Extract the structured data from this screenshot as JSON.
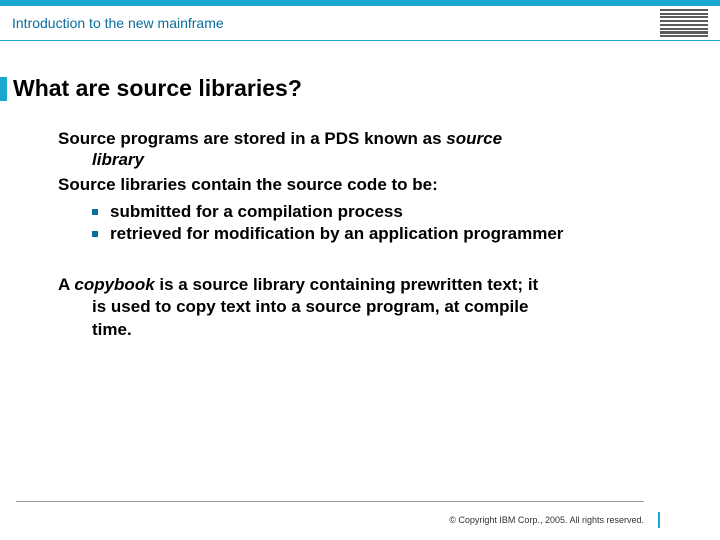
{
  "header": {
    "title": "Introduction to the new mainframe",
    "logo_name": "IBM"
  },
  "slide": {
    "title": "What are source libraries?",
    "para1_a": "Source programs are stored in a PDS known as ",
    "para1_b_italic": "source",
    "para1_c_italic": "library",
    "para2": "Source libraries contain the source code to be:",
    "bullets": [
      "submitted for a compilation process",
      "retrieved for modification by an application programmer"
    ],
    "para3_a": "A ",
    "para3_b_italic": "copybook",
    "para3_c": " is a source library containing prewritten text; it",
    "para3_d": "is used to copy text into a source program, at compile",
    "para3_e": "time."
  },
  "footer": {
    "copyright": "© Copyright IBM Corp., 2005. All rights reserved."
  }
}
